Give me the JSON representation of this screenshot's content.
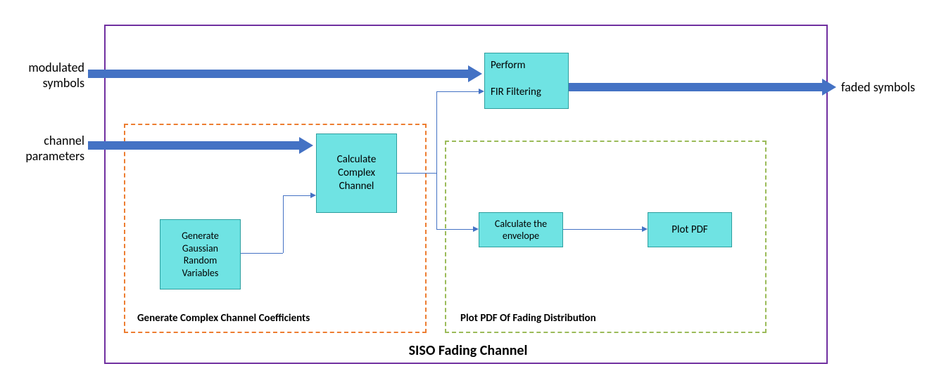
{
  "labels": {
    "input_top": "modulated\nsymbols",
    "input_bottom": "channel\nparameters",
    "output": "faded symbols"
  },
  "boxes": {
    "fir": "Perform\n\nFIR Filtering",
    "calc_channel": "Calculate\nComplex\nChannel",
    "gaussian": "Generate\nGaussian\nRandom\nVariables",
    "envelope": "Calculate the\nenvelope",
    "plotpdf": "Plot PDF"
  },
  "titles": {
    "main": "SISO Fading Channel",
    "orange": "Generate Complex Channel Coefficients",
    "green": "Plot PDF Of Fading Distribution"
  },
  "colors": {
    "outer_border": "#7030A0",
    "orange_dash": "#ED7D31",
    "green_dash": "#9BBB59",
    "box_fill": "#6FE3E3",
    "arrow": "#4472C4"
  }
}
